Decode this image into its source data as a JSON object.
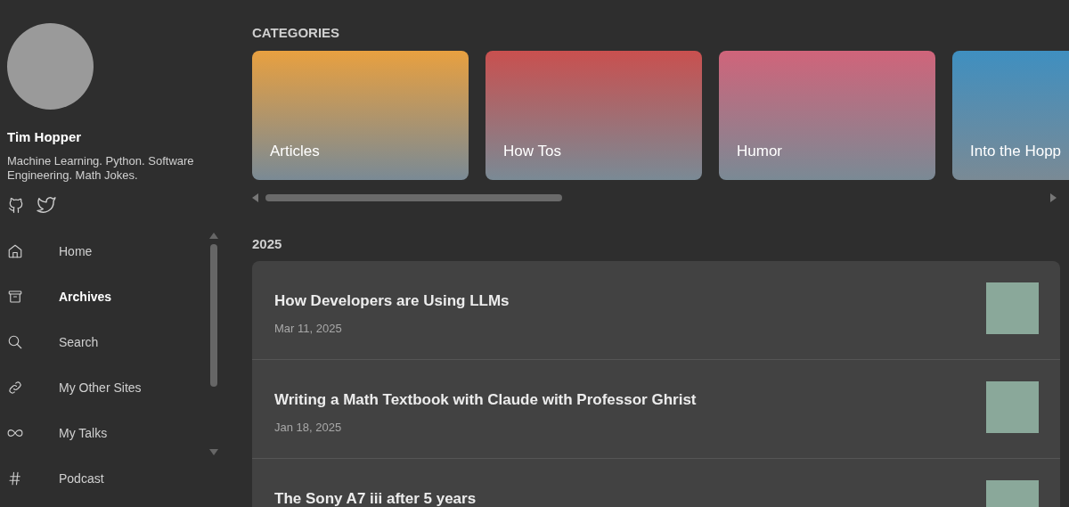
{
  "profile": {
    "name": "Tim Hopper",
    "bio": "Machine Learning. Python. Software Engineering. Math Jokes."
  },
  "social": [
    {
      "kind": "github"
    },
    {
      "kind": "twitter"
    }
  ],
  "nav": [
    {
      "label": "Home",
      "kind": "home",
      "selected": false
    },
    {
      "label": "Archives",
      "kind": "archive",
      "selected": true
    },
    {
      "label": "Search",
      "kind": "search",
      "selected": false
    },
    {
      "label": "My Other Sites",
      "kind": "link",
      "selected": false
    },
    {
      "label": "My Talks",
      "kind": "infinity",
      "selected": false
    },
    {
      "label": "Podcast",
      "kind": "hash",
      "selected": false
    }
  ],
  "categories": {
    "heading": "CATEGORIES",
    "items": [
      {
        "label": "Articles",
        "color": "#e8a040"
      },
      {
        "label": "How Tos",
        "color": "#c9504f"
      },
      {
        "label": "Humor",
        "color": "#d0647a"
      },
      {
        "label": "Into the Hopp",
        "color": "#3f8fc0"
      }
    ]
  },
  "year": "2025",
  "posts": [
    {
      "title": "How Developers are Using LLMs",
      "date": "Mar 11, 2025"
    },
    {
      "title": "Writing a Math Textbook with Claude with Professor Ghrist",
      "date": "Jan 18, 2025"
    },
    {
      "title": "The Sony A7 iii after 5 years"
    }
  ]
}
